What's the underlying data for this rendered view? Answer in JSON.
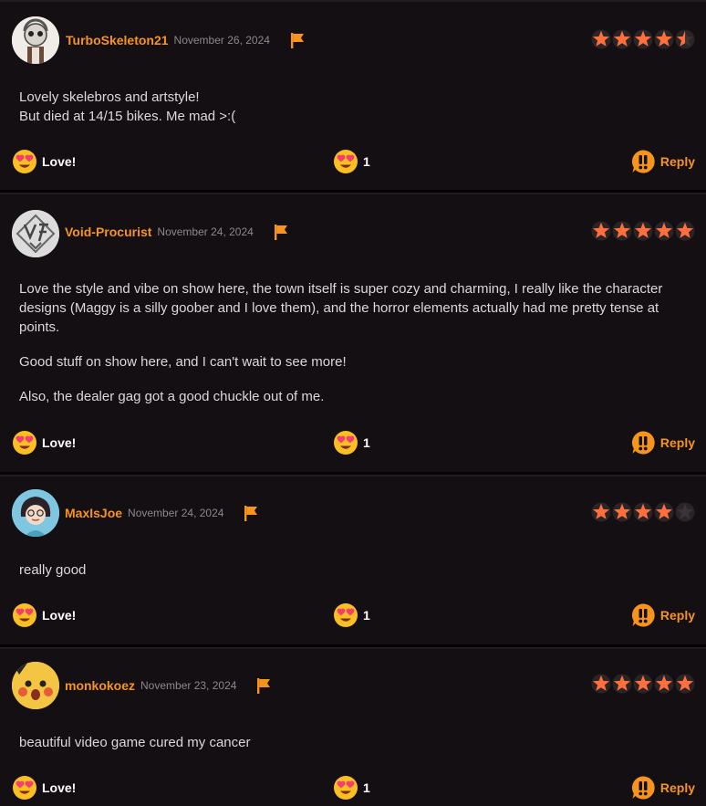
{
  "colors": {
    "accent": "#f7941d",
    "star_filled": "#ff6f3c",
    "star_empty": "#3a3436",
    "background": "#140f12"
  },
  "icons": {
    "love": "heart-eyes-emoji-icon",
    "reply": "speech-exclaim-icon",
    "flag": "flag-icon",
    "star": "star-icon"
  },
  "reviews": [
    {
      "username": "TurboSkeleton21",
      "date": "November 26, 2024",
      "rating": 4.5,
      "paragraphs": [
        "Lovely skelebros and artstyle!\nBut died at 14/15 bikes. Me mad >:("
      ],
      "love_label": "Love!",
      "count": "1",
      "reply_label": "Reply"
    },
    {
      "username": "Void-Procurist",
      "date": "November 24, 2024",
      "rating": 5,
      "paragraphs": [
        "Love the style and vibe on show here, the town itself is super cozy and charming, I really like the character designs (Maggy is a silly goober and I love them), and the horror elements actually had me pretty tense at points.",
        "Good stuff on show here, and I can't wait to see more!",
        "Also, the dealer gag got a good chuckle out of me."
      ],
      "love_label": "Love!",
      "count": "1",
      "reply_label": "Reply"
    },
    {
      "username": "MaxIsJoe",
      "date": "November 24, 2024",
      "rating": 4,
      "paragraphs": [
        "really good"
      ],
      "love_label": "Love!",
      "count": "1",
      "reply_label": "Reply"
    },
    {
      "username": "monkokoez",
      "date": "November 23, 2024",
      "rating": 5,
      "paragraphs": [
        "beautiful video game cured my cancer"
      ],
      "love_label": "Love!",
      "count": "1",
      "reply_label": "Reply"
    }
  ]
}
